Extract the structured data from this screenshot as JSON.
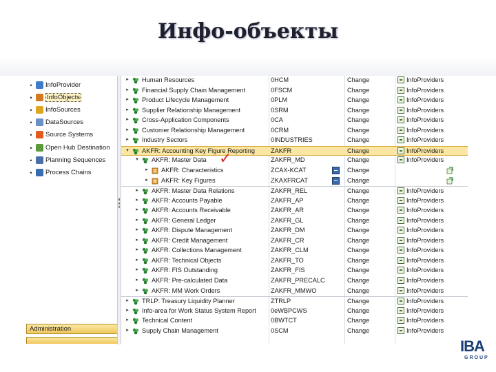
{
  "title": "Инфо-объекты",
  "left_nav": {
    "items": [
      {
        "label": "InfoProvider",
        "icon": "infoprovider-icon",
        "color": "#3e7bc8",
        "selected": false
      },
      {
        "label": "InfoObjects",
        "icon": "infoobjects-icon",
        "color": "#d27a1e",
        "selected": true
      },
      {
        "label": "InfoSources",
        "icon": "infosources-icon",
        "color": "#e0a520",
        "selected": false
      },
      {
        "label": "DataSources",
        "icon": "datasources-icon",
        "color": "#6b8fc7",
        "selected": false
      },
      {
        "label": "Source Systems",
        "icon": "source-systems-icon",
        "color": "#e35a1c",
        "selected": false
      },
      {
        "label": "Open Hub Destination",
        "icon": "open-hub-icon",
        "color": "#5a9a3a",
        "selected": false
      },
      {
        "label": "Planning Sequences",
        "icon": "planning-sequences-icon",
        "color": "#4a6ea8",
        "selected": false
      },
      {
        "label": "Process Chains",
        "icon": "process-chains-icon",
        "color": "#3a6cb0",
        "selected": false
      }
    ],
    "admin_label": "Administration"
  },
  "tree": {
    "rows": [
      {
        "level": 0,
        "expander": "▸",
        "name": "Human Resources",
        "tech": "0HCM",
        "action": "Change",
        "status": "InfoProviders",
        "icon": "infoarea-icon"
      },
      {
        "level": 0,
        "expander": "▸",
        "name": "Financial Supply Chain Management",
        "tech": "0FSCM",
        "action": "Change",
        "status": "InfoProviders",
        "icon": "infoarea-icon"
      },
      {
        "level": 0,
        "expander": "▸",
        "name": "Product Lifecycle Management",
        "tech": "0PLM",
        "action": "Change",
        "status": "InfoProviders",
        "icon": "infoarea-icon"
      },
      {
        "level": 0,
        "expander": "▸",
        "name": "Supplier Relationship Management",
        "tech": "0SRM",
        "action": "Change",
        "status": "InfoProviders",
        "icon": "infoarea-icon"
      },
      {
        "level": 0,
        "expander": "▸",
        "name": "Cross-Application Components",
        "tech": "0CA",
        "action": "Change",
        "status": "InfoProviders",
        "icon": "infoarea-icon"
      },
      {
        "level": 0,
        "expander": "▸",
        "name": "Customer Relationship Management",
        "tech": "0CRM",
        "action": "Change",
        "status": "InfoProviders",
        "icon": "infoarea-icon"
      },
      {
        "level": 0,
        "expander": "▸",
        "name": "Industry Sectors",
        "tech": "0INDUSTRIES",
        "action": "Change",
        "status": "InfoProviders",
        "icon": "infoarea-icon"
      },
      {
        "level": 0,
        "expander": "▾",
        "name": "AKFR: Accounting Key Figure Reporting",
        "tech": "ZAKFR",
        "action": "Change",
        "status": "InfoProviders",
        "icon": "infoarea-icon",
        "highlight": true
      },
      {
        "level": 1,
        "expander": "▾",
        "name": "AKFR: Master Data",
        "tech": "ZAKFR_MD",
        "action": "Change",
        "status": "InfoProviders",
        "icon": "infoarea-icon"
      },
      {
        "level": 2,
        "expander": "▸",
        "name": "AKFR: Characteristics",
        "tech": "ZCAX-KCAT",
        "action": "Change",
        "status": "",
        "icon": "catalog-icon",
        "button": true
      },
      {
        "level": 2,
        "expander": "▸",
        "name": "AKFR: Key Figures",
        "tech": "ZKAXFRCAT",
        "action": "Change",
        "status": "",
        "icon": "catalog-icon",
        "button": true
      },
      {
        "level": 1,
        "expander": "▸",
        "name": "AKFR: Master Data Relations",
        "tech": "ZAKFR_REL",
        "action": "Change",
        "status": "InfoProviders",
        "icon": "infoarea-icon",
        "sep": true
      },
      {
        "level": 1,
        "expander": "▸",
        "name": "AKFR: Accounts Payable",
        "tech": "ZAKFR_AP",
        "action": "Change",
        "status": "InfoProviders",
        "icon": "infoarea-icon"
      },
      {
        "level": 1,
        "expander": "▸",
        "name": "AKFR: Accounts Receivable",
        "tech": "ZAKFR_AR",
        "action": "Change",
        "status": "InfoProviders",
        "icon": "infoarea-icon"
      },
      {
        "level": 1,
        "expander": "▸",
        "name": "AKFR: General Ledger",
        "tech": "ZAKFR_GL",
        "action": "Change",
        "status": "InfoProviders",
        "icon": "infoarea-icon"
      },
      {
        "level": 1,
        "expander": "▸",
        "name": "AKFR: Dispute Management",
        "tech": "ZAKFR_DM",
        "action": "Change",
        "status": "InfoProviders",
        "icon": "infoarea-icon"
      },
      {
        "level": 1,
        "expander": "▸",
        "name": "AKFR: Credit Management",
        "tech": "ZAKFR_CR",
        "action": "Change",
        "status": "InfoProviders",
        "icon": "infoarea-icon"
      },
      {
        "level": 1,
        "expander": "▸",
        "name": "AKFR: Collections Management",
        "tech": "ZAKFR_CLM",
        "action": "Change",
        "status": "InfoProviders",
        "icon": "infoarea-icon"
      },
      {
        "level": 1,
        "expander": "▸",
        "name": "AKFR: Technical Objects",
        "tech": "ZAKFR_TO",
        "action": "Change",
        "status": "InfoProviders",
        "icon": "infoarea-icon"
      },
      {
        "level": 1,
        "expander": "▸",
        "name": "AKFR: FIS Outstanding",
        "tech": "ZAKFR_FIS",
        "action": "Change",
        "status": "InfoProviders",
        "icon": "infoarea-icon"
      },
      {
        "level": 1,
        "expander": "▸",
        "name": "AKFR: Pre-calculated Data",
        "tech": "ZAKFR_PRECALC",
        "action": "Change",
        "status": "InfoProviders",
        "icon": "infoarea-icon"
      },
      {
        "level": 1,
        "expander": "▸",
        "name": "AKFR: MM Work Orders",
        "tech": "ZAKFR_MMWO",
        "action": "Change",
        "status": "InfoProviders",
        "icon": "infoarea-icon"
      },
      {
        "level": 0,
        "expander": "▸",
        "name": "TRLP: Treasury Liquidity Planner",
        "tech": "ZTRLP",
        "action": "Change",
        "status": "InfoProviders",
        "icon": "infoarea-icon",
        "sep": true
      },
      {
        "level": 0,
        "expander": "▸",
        "name": "Info-area for Work Status System Report",
        "tech": "0eWBPCWS",
        "action": "Change",
        "status": "InfoProviders",
        "icon": "infoarea-icon"
      },
      {
        "level": 0,
        "expander": "▸",
        "name": "Technical Content",
        "tech": "0BWTCT",
        "action": "Change",
        "status": "InfoProviders",
        "icon": "infoarea-icon"
      },
      {
        "level": 0,
        "expander": "▸",
        "name": "Supply Chain Management",
        "tech": "0SCM",
        "action": "Change",
        "status": "InfoProviders",
        "icon": "infoarea-icon"
      }
    ]
  },
  "logo": {
    "text": "IBA",
    "sub": "GROUP"
  },
  "colors": {
    "highlight": "#fbe7a3",
    "checkmark": "#d22a2a",
    "infoarea": "#2f8a3c",
    "brand": "#1a3f7a"
  }
}
